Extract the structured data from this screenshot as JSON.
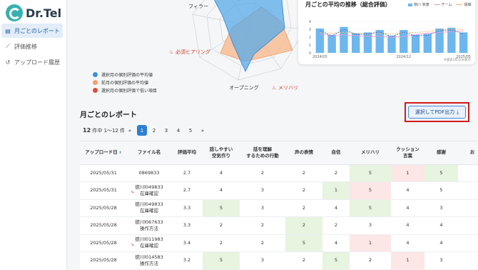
{
  "app": {
    "logo_text": "Dr.Tel"
  },
  "sidebar": {
    "items": [
      {
        "label": "月ごとのレポート",
        "icon": "report-icon",
        "active": true
      },
      {
        "label": "評価推移",
        "icon": "line-chart-icon",
        "active": false
      },
      {
        "label": "アップロード履歴",
        "icon": "history-icon",
        "active": false
      }
    ]
  },
  "radar": {
    "labels": {
      "filler": "フィラー",
      "must_hearing": "必須ヒアリング",
      "opening": "オープニング",
      "merihari": "メリハリ"
    },
    "legend": [
      {
        "label": "選択月の個別評価の平均値",
        "color": "#3d8fd6"
      },
      {
        "label": "前月の個別評価の平均値",
        "color": "#f4a06b"
      },
      {
        "label": "選択月の個別評価で低い項目",
        "color": "#e04a3a"
      }
    ]
  },
  "trend": {
    "title": "月ごとの平均の推移（総合評価）",
    "legend": {
      "user": "徳川 家康",
      "team": "チーム",
      "all": "組織"
    },
    "note": "※過去1年のみ表示",
    "colors": {
      "bar": "#6db7ee",
      "team": "#e89bd0",
      "all": "#f0b25a",
      "user_line": "#3a6fd6"
    },
    "chart_data": {
      "type": "bar",
      "x_labels": [
        "2024/05",
        "2024/12",
        "2025/05"
      ],
      "categories": [
        "2024/05",
        "2024/06",
        "2024/07",
        "2024/08",
        "2024/09",
        "2024/10",
        "2024/11",
        "2024/12",
        "2025/01",
        "2025/02",
        "2025/03",
        "2025/04",
        "2025/05"
      ],
      "ylim": [
        0,
        4
      ],
      "yticks": [
        "0",
        "1",
        "2",
        "3",
        "4"
      ],
      "series": [
        {
          "name": "徳川 家康",
          "values": [
            3.1,
            2.3,
            3.3,
            2.5,
            2.6,
            2.9,
            2.2,
            2.9,
            2.3,
            2.4,
            3.1,
            3.2,
            2.6
          ]
        },
        {
          "name": "チーム",
          "values": [
            2.4,
            2.2,
            2.3,
            2.2,
            2.1,
            2.1,
            2.0,
            2.1,
            2.3,
            2.5,
            2.6,
            2.7,
            2.8
          ]
        },
        {
          "name": "組織",
          "values": [
            2.6,
            2.5,
            2.6,
            2.5,
            2.4,
            2.5,
            2.4,
            2.6,
            2.6,
            2.7,
            2.9,
            3.0,
            3.0
          ]
        }
      ]
    }
  },
  "report": {
    "title": "月ごとのレポート",
    "pdf_button": "選択してPDF出力",
    "count_total": "12",
    "count_text": " 件中 1〜12 件",
    "pager": {
      "first": "«",
      "pages": [
        "1",
        "2",
        "3",
        "4",
        "5"
      ],
      "last": "»",
      "active": "1"
    },
    "columns": [
      "アップロード日",
      "ファイル名",
      "評価平均",
      "話しやすい\n空気作り",
      "話を理解\nするための行動",
      "声の表情",
      "自信",
      "メリハリ",
      "クッション\n言葉",
      "感謝",
      "お"
    ],
    "rows": [
      {
        "date": "2025/05/31",
        "file": "0869833",
        "trend": false,
        "avg": "2.7",
        "v": [
          "4",
          "2",
          "2",
          "2",
          "5",
          "1",
          "5"
        ],
        "c": [
          "",
          "",
          "",
          "",
          "g",
          "r",
          "g"
        ]
      },
      {
        "date": "2025/05/31",
        "file": "徳川l049833\n在庫確認",
        "trend": true,
        "avg": "2.7",
        "v": [
          "4",
          "3",
          "2",
          "1",
          "5",
          "4",
          "5"
        ],
        "c": [
          "",
          "",
          "",
          "g",
          "r",
          "",
          ""
        ]
      },
      {
        "date": "2025/05/28",
        "file": "徳川l049833\n在庫確認",
        "trend": false,
        "avg": "3.3",
        "v": [
          "5",
          "3",
          "2",
          "4",
          "5",
          "4",
          "3"
        ],
        "c": [
          "g",
          "",
          "",
          "",
          "g",
          "",
          ""
        ]
      },
      {
        "date": "2025/05/28",
        "file": "徳川l067633\n操作方法",
        "trend": false,
        "avg": "3.3",
        "v": [
          "2",
          "2",
          "2",
          "2",
          "3",
          "4",
          "4"
        ],
        "c": [
          "",
          "",
          "g",
          "",
          "",
          "",
          ""
        ]
      },
      {
        "date": "2025/05/28",
        "file": "徳川l011983\n在庫確認",
        "trend": true,
        "avg": "3.4",
        "v": [
          "2",
          "2",
          "5",
          "4",
          "1",
          "4",
          "4"
        ],
        "c": [
          "",
          "",
          "g",
          "",
          "r",
          "",
          ""
        ]
      },
      {
        "date": "2025/05/28",
        "file": "徳川l014583\n操作方法",
        "trend": false,
        "avg": "3.2",
        "v": [
          "5",
          "3",
          "2",
          "5",
          "2",
          "1",
          "3"
        ],
        "c": [
          "g",
          "",
          "",
          "g",
          "",
          "r",
          ""
        ]
      }
    ]
  }
}
